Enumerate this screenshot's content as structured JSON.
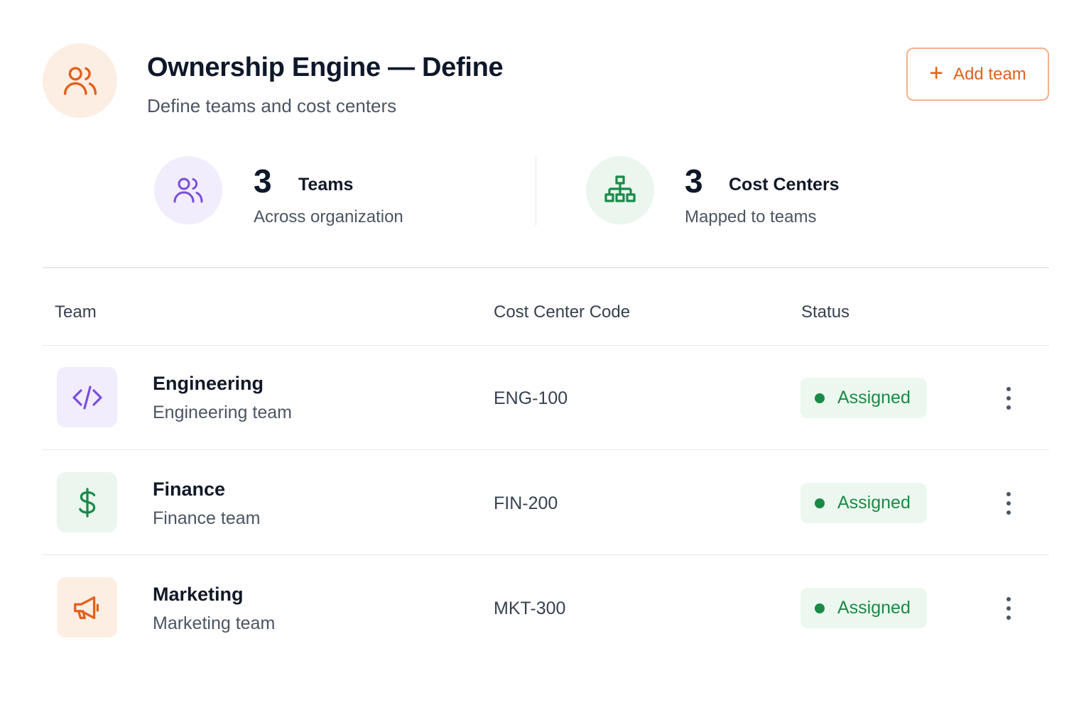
{
  "header": {
    "title": "Ownership Engine — Define",
    "subtitle": "Define teams and cost centers",
    "icon": "users-icon",
    "add_button_label": "Add team"
  },
  "stats": [
    {
      "value": "3",
      "label": "Teams",
      "sub": "Across organization",
      "icon": "users-icon",
      "color": "#7c4ddb"
    },
    {
      "value": "3",
      "label": "Cost Centers",
      "sub": "Mapped to teams",
      "icon": "hierarchy-icon",
      "color": "#1a8a47"
    }
  ],
  "table": {
    "columns": [
      "Team",
      "Cost Center Code",
      "Status"
    ],
    "rows": [
      {
        "name": "Engineering",
        "description": "Engineering team",
        "code": "ENG-100",
        "status": "Assigned",
        "icon": "code-icon"
      },
      {
        "name": "Finance",
        "description": "Finance team",
        "code": "FIN-200",
        "status": "Assigned",
        "icon": "dollar-icon"
      },
      {
        "name": "Marketing",
        "description": "Marketing team",
        "code": "MKT-300",
        "status": "Assigned",
        "icon": "megaphone-icon"
      }
    ]
  },
  "colors": {
    "accent": "#e2601a",
    "purple": "#7c4ddb",
    "green": "#1a8a47"
  }
}
